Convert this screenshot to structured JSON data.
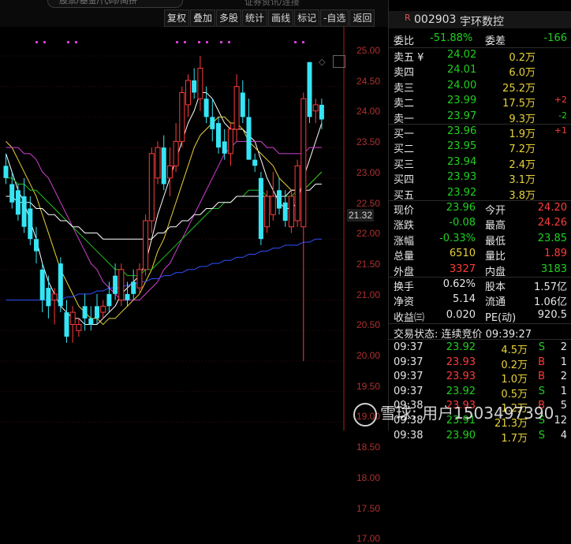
{
  "search": {
    "placeholder": "股票/基金/代码/简拼"
  },
  "top_hint": "证券资讯/连接",
  "toolbar": {
    "items": [
      "复权",
      "叠加",
      "多股",
      "统计",
      "画线",
      "标记",
      "-自选",
      "返回"
    ]
  },
  "chart": {
    "price_ticks": [
      "25.00",
      "24.50",
      "24.00",
      "23.50",
      "23.00",
      "22.50",
      "22.00",
      "21.50",
      "21.00",
      "20.50",
      "20.00",
      "19.50",
      "19.00",
      "18.50",
      "18.00",
      "17.50",
      "17.00"
    ],
    "current_price_label": "21.32",
    "colors": {
      "up": "#ff3b3b",
      "down": "#35e5f5",
      "ma5": "#ffffff",
      "ma10": "#e8d23a",
      "ma20": "#d040d0",
      "ma30": "#20c020",
      "ma60": "#ffffff",
      "ma120": "#3050ff"
    },
    "candles": [
      {
        "o": 23.2,
        "h": 23.4,
        "l": 22.9,
        "c": 23.0
      },
      {
        "o": 22.9,
        "h": 23.1,
        "l": 22.5,
        "c": 22.6
      },
      {
        "o": 22.8,
        "h": 22.9,
        "l": 22.3,
        "c": 22.4
      },
      {
        "o": 22.7,
        "h": 23.0,
        "l": 22.1,
        "c": 22.2
      },
      {
        "o": 22.5,
        "h": 22.7,
        "l": 21.9,
        "c": 22.0
      },
      {
        "o": 22.0,
        "h": 22.2,
        "l": 21.6,
        "c": 21.8
      },
      {
        "o": 21.5,
        "h": 21.6,
        "l": 20.8,
        "c": 21.0
      },
      {
        "o": 21.2,
        "h": 21.4,
        "l": 20.7,
        "c": 20.9
      },
      {
        "o": 21.0,
        "h": 21.2,
        "l": 20.6,
        "c": 21.1
      },
      {
        "o": 21.6,
        "h": 21.7,
        "l": 20.8,
        "c": 20.9
      },
      {
        "o": 20.8,
        "h": 21.0,
        "l": 20.3,
        "c": 20.4
      },
      {
        "o": 20.6,
        "h": 20.9,
        "l": 20.3,
        "c": 20.8
      },
      {
        "o": 20.5,
        "h": 20.7,
        "l": 20.4,
        "c": 20.6
      },
      {
        "o": 20.9,
        "h": 21.1,
        "l": 20.5,
        "c": 20.7
      },
      {
        "o": 20.7,
        "h": 20.9,
        "l": 20.5,
        "c": 20.6
      },
      {
        "o": 20.9,
        "h": 21.1,
        "l": 20.6,
        "c": 20.7
      },
      {
        "o": 20.8,
        "h": 21.0,
        "l": 20.7,
        "c": 20.9
      },
      {
        "o": 21.1,
        "h": 21.3,
        "l": 20.8,
        "c": 20.9
      },
      {
        "o": 21.4,
        "h": 21.6,
        "l": 21.0,
        "c": 21.1
      },
      {
        "o": 21.0,
        "h": 21.6,
        "l": 20.9,
        "c": 21.5
      },
      {
        "o": 21.1,
        "h": 21.3,
        "l": 20.9,
        "c": 21.0
      },
      {
        "o": 21.3,
        "h": 21.5,
        "l": 21.0,
        "c": 21.1
      },
      {
        "o": 21.2,
        "h": 21.6,
        "l": 21.1,
        "c": 21.5
      },
      {
        "o": 21.5,
        "h": 22.4,
        "l": 21.4,
        "c": 22.3
      },
      {
        "o": 22.3,
        "h": 23.5,
        "l": 22.1,
        "c": 23.4
      },
      {
        "o": 23.0,
        "h": 23.6,
        "l": 22.9,
        "c": 23.5
      },
      {
        "o": 23.5,
        "h": 23.7,
        "l": 22.8,
        "c": 22.9
      },
      {
        "o": 23.0,
        "h": 23.5,
        "l": 22.7,
        "c": 23.2
      },
      {
        "o": 23.2,
        "h": 23.9,
        "l": 23.1,
        "c": 23.6
      },
      {
        "o": 23.6,
        "h": 24.5,
        "l": 23.5,
        "c": 24.4
      },
      {
        "o": 24.2,
        "h": 24.7,
        "l": 24.0,
        "c": 24.6
      },
      {
        "o": 24.6,
        "h": 24.8,
        "l": 24.3,
        "c": 24.4
      },
      {
        "o": 24.3,
        "h": 25.0,
        "l": 24.1,
        "c": 24.8
      },
      {
        "o": 24.3,
        "h": 24.5,
        "l": 23.9,
        "c": 24.0
      },
      {
        "o": 24.0,
        "h": 24.3,
        "l": 23.6,
        "c": 23.8
      },
      {
        "o": 23.9,
        "h": 24.0,
        "l": 23.4,
        "c": 23.5
      },
      {
        "o": 23.6,
        "h": 23.8,
        "l": 23.3,
        "c": 23.4
      },
      {
        "o": 23.4,
        "h": 23.9,
        "l": 23.2,
        "c": 23.8
      },
      {
        "o": 23.8,
        "h": 24.7,
        "l": 23.6,
        "c": 24.5
      },
      {
        "o": 24.4,
        "h": 24.6,
        "l": 23.9,
        "c": 24.0
      },
      {
        "o": 24.0,
        "h": 24.3,
        "l": 23.3,
        "c": 23.3
      },
      {
        "o": 23.3,
        "h": 23.4,
        "l": 23.1,
        "c": 23.2
      },
      {
        "o": 23.0,
        "h": 23.1,
        "l": 21.9,
        "c": 22.0
      },
      {
        "o": 22.2,
        "h": 22.8,
        "l": 22.1,
        "c": 22.7
      },
      {
        "o": 22.4,
        "h": 23.1,
        "l": 22.3,
        "c": 22.7
      },
      {
        "o": 22.8,
        "h": 23.0,
        "l": 22.4,
        "c": 22.5
      },
      {
        "o": 22.6,
        "h": 22.8,
        "l": 22.2,
        "c": 22.3
      },
      {
        "o": 22.2,
        "h": 22.8,
        "l": 22.1,
        "c": 22.7
      },
      {
        "o": 22.3,
        "h": 23.3,
        "l": 22.2,
        "c": 23.2
      },
      {
        "o": 22.2,
        "h": 24.4,
        "l": 20.0,
        "c": 24.3
      },
      {
        "o": 24.9,
        "h": 24.9,
        "l": 23.9,
        "c": 24.0
      },
      {
        "o": 24.1,
        "h": 24.3,
        "l": 23.9,
        "c": 24.2
      },
      {
        "o": 24.2,
        "h": 24.3,
        "l": 23.8,
        "c": 23.96
      }
    ],
    "ma_lines": {
      "ma5": [
        23.4,
        23.1,
        22.8,
        22.6,
        22.3,
        22.0,
        21.6,
        21.3,
        21.1,
        20.9,
        20.8,
        20.7,
        20.7,
        20.6,
        20.6,
        20.6,
        20.7,
        20.8,
        20.9,
        21.1,
        21.2,
        21.3,
        21.4,
        21.6,
        22.0,
        22.4,
        22.7,
        23.0,
        23.3,
        23.6,
        23.9,
        24.1,
        24.4,
        24.4,
        24.3,
        24.1,
        23.9,
        23.8,
        23.8,
        23.8,
        23.7,
        23.6,
        23.3,
        23.0,
        22.8,
        22.6,
        22.5,
        22.5,
        22.6,
        23.0,
        23.3,
        23.6,
        23.9
      ],
      "ma10": [
        23.6,
        23.5,
        23.3,
        23.1,
        22.9,
        22.7,
        22.4,
        22.1,
        21.8,
        21.5,
        21.3,
        21.1,
        20.9,
        20.8,
        20.7,
        20.7,
        20.6,
        20.7,
        20.7,
        20.8,
        20.9,
        21.0,
        21.1,
        21.3,
        21.5,
        21.8,
        22.0,
        22.3,
        22.6,
        22.9,
        23.2,
        23.5,
        23.7,
        23.8,
        23.9,
        24.0,
        24.0,
        23.9,
        23.9,
        23.8,
        23.6,
        23.5,
        23.4,
        23.3,
        23.2,
        23.0,
        22.9,
        22.8,
        22.8,
        22.8,
        22.9,
        23.0,
        23.1
      ],
      "ma20": [
        23.5,
        23.5,
        23.5,
        23.4,
        23.4,
        23.3,
        23.1,
        23.0,
        22.8,
        22.6,
        22.4,
        22.2,
        22.0,
        21.8,
        21.6,
        21.5,
        21.3,
        21.2,
        21.1,
        21.0,
        21.0,
        21.0,
        21.0,
        21.1,
        21.2,
        21.3,
        21.5,
        21.6,
        21.8,
        22.0,
        22.2,
        22.4,
        22.6,
        22.8,
        23.0,
        23.2,
        23.4,
        23.5,
        23.6,
        23.6,
        23.6,
        23.6,
        23.6,
        23.5,
        23.5,
        23.4,
        23.4,
        23.4,
        23.4,
        23.4,
        23.5,
        23.5,
        23.5
      ],
      "ma30": [
        23.0,
        23.0,
        22.9,
        22.9,
        22.8,
        22.8,
        22.7,
        22.6,
        22.5,
        22.4,
        22.3,
        22.2,
        22.1,
        22.0,
        21.9,
        21.8,
        21.7,
        21.6,
        21.5,
        21.5,
        21.4,
        21.4,
        21.4,
        21.5,
        21.5,
        21.6,
        21.7,
        21.8,
        21.9,
        22.0,
        22.1,
        22.2,
        22.3,
        22.4,
        22.5,
        22.5,
        22.6,
        22.6,
        22.7,
        22.7,
        22.8,
        22.8,
        22.8,
        22.7,
        22.7,
        22.7,
        22.7,
        22.7,
        22.8,
        22.8,
        22.9,
        23.0,
        23.1
      ],
      "ma60": [
        22.7,
        22.7,
        22.6,
        22.6,
        22.6,
        22.5,
        22.5,
        22.4,
        22.4,
        22.3,
        22.3,
        22.2,
        22.2,
        22.1,
        22.1,
        22.1,
        22.0,
        22.0,
        22.0,
        22.0,
        22.0,
        22.0,
        22.0,
        22.0,
        22.0,
        22.1,
        22.1,
        22.2,
        22.2,
        22.3,
        22.3,
        22.4,
        22.4,
        22.5,
        22.5,
        22.6,
        22.6,
        22.6,
        22.7,
        22.7,
        22.7,
        22.7,
        22.7,
        22.7,
        22.7,
        22.7,
        22.7,
        22.8,
        22.8,
        22.8,
        22.8,
        22.9,
        22.9
      ],
      "ma120": [
        21.0,
        21.0,
        21.0,
        21.0,
        21.0,
        21.0,
        21.0,
        21.0,
        21.0,
        21.0,
        21.05,
        21.05,
        21.1,
        21.1,
        21.1,
        21.15,
        21.15,
        21.2,
        21.2,
        21.2,
        21.25,
        21.25,
        21.3,
        21.3,
        21.35,
        21.35,
        21.4,
        21.4,
        21.45,
        21.45,
        21.5,
        21.5,
        21.55,
        21.55,
        21.6,
        21.6,
        21.65,
        21.65,
        21.7,
        21.7,
        21.75,
        21.75,
        21.8,
        21.8,
        21.85,
        21.85,
        21.9,
        21.9,
        21.9,
        21.95,
        21.95,
        22.0,
        22.0
      ]
    }
  },
  "stock": {
    "code": "002903",
    "name": "宇环数控",
    "r_mark": "R"
  },
  "commission": {
    "ratio_label": "委比",
    "ratio_value": "-51.88%",
    "diff_label": "委差",
    "diff_value": "-166"
  },
  "asks": [
    {
      "label": "卖五 ¥",
      "price": "24.02",
      "vol": "0.2万",
      "chg": ""
    },
    {
      "label": "卖四",
      "price": "24.01",
      "vol": "6.0万",
      "chg": ""
    },
    {
      "label": "卖三",
      "price": "24.00",
      "vol": "25.2万",
      "chg": ""
    },
    {
      "label": "卖二",
      "price": "23.99",
      "vol": "17.5万",
      "chg": "+2"
    },
    {
      "label": "卖一",
      "price": "23.97",
      "vol": "9.3万",
      "chg": "-2"
    }
  ],
  "bids": [
    {
      "label": "买一",
      "price": "23.96",
      "vol": "1.9万",
      "chg": "+1"
    },
    {
      "label": "买二",
      "price": "23.95",
      "vol": "7.2万",
      "chg": ""
    },
    {
      "label": "买三",
      "price": "23.94",
      "vol": "2.4万",
      "chg": ""
    },
    {
      "label": "买四",
      "price": "23.93",
      "vol": "3.1万",
      "chg": ""
    },
    {
      "label": "买五",
      "price": "23.92",
      "vol": "3.8万",
      "chg": ""
    }
  ],
  "quote": [
    {
      "l1": "现价",
      "v1": "23.96",
      "c1": "green",
      "l2": "今开",
      "v2": "24.20",
      "c2": "red"
    },
    {
      "l1": "涨跌",
      "v1": "-0.08",
      "c1": "green",
      "l2": "最高",
      "v2": "24.26",
      "c2": "red"
    },
    {
      "l1": "涨幅",
      "v1": "-0.33%",
      "c1": "green",
      "l2": "最低",
      "v2": "23.85",
      "c2": "green"
    },
    {
      "l1": "总量",
      "v1": "6510",
      "c1": "yellow",
      "l2": "量比",
      "v2": "1.89",
      "c2": "red"
    },
    {
      "l1": "外盘",
      "v1": "3327",
      "c1": "red",
      "l2": "内盘",
      "v2": "3183",
      "c2": "green"
    }
  ],
  "fundamentals": [
    {
      "l1": "换手",
      "v1": "0.62%",
      "l2": "股本",
      "v2": "1.57亿"
    },
    {
      "l1": "净资",
      "v1": "5.14",
      "l2": "流通",
      "v2": "1.06亿"
    },
    {
      "l1": "收益㈢",
      "v1": "0.020",
      "l2": "PE(动)",
      "v2": "920.5"
    }
  ],
  "trade_status": "交易状态: 连续竞价 09:39:27",
  "ticks": [
    {
      "time": "09:37",
      "price": "23.92",
      "vol": "4.5万",
      "side": "S",
      "n": "2"
    },
    {
      "time": "09:37",
      "price": "23.93",
      "vol": "0.2万",
      "side": "B",
      "n": "1"
    },
    {
      "time": "09:37",
      "price": "23.93",
      "vol": "1.0万",
      "side": "B",
      "n": "2"
    },
    {
      "time": "09:37",
      "price": "23.92",
      "vol": "0.5万",
      "side": "S",
      "n": "1"
    },
    {
      "time": "09:38",
      "price": "23.93",
      "vol": "1.2万",
      "side": "B",
      "n": "5"
    },
    {
      "time": "09:38",
      "price": "23.91",
      "vol": "21.3万",
      "side": "S",
      "n": "12"
    },
    {
      "time": "09:38",
      "price": "23.90",
      "vol": "1.7万",
      "side": "S",
      "n": "4"
    }
  ],
  "watermark": "雪球: 用户1503497390"
}
